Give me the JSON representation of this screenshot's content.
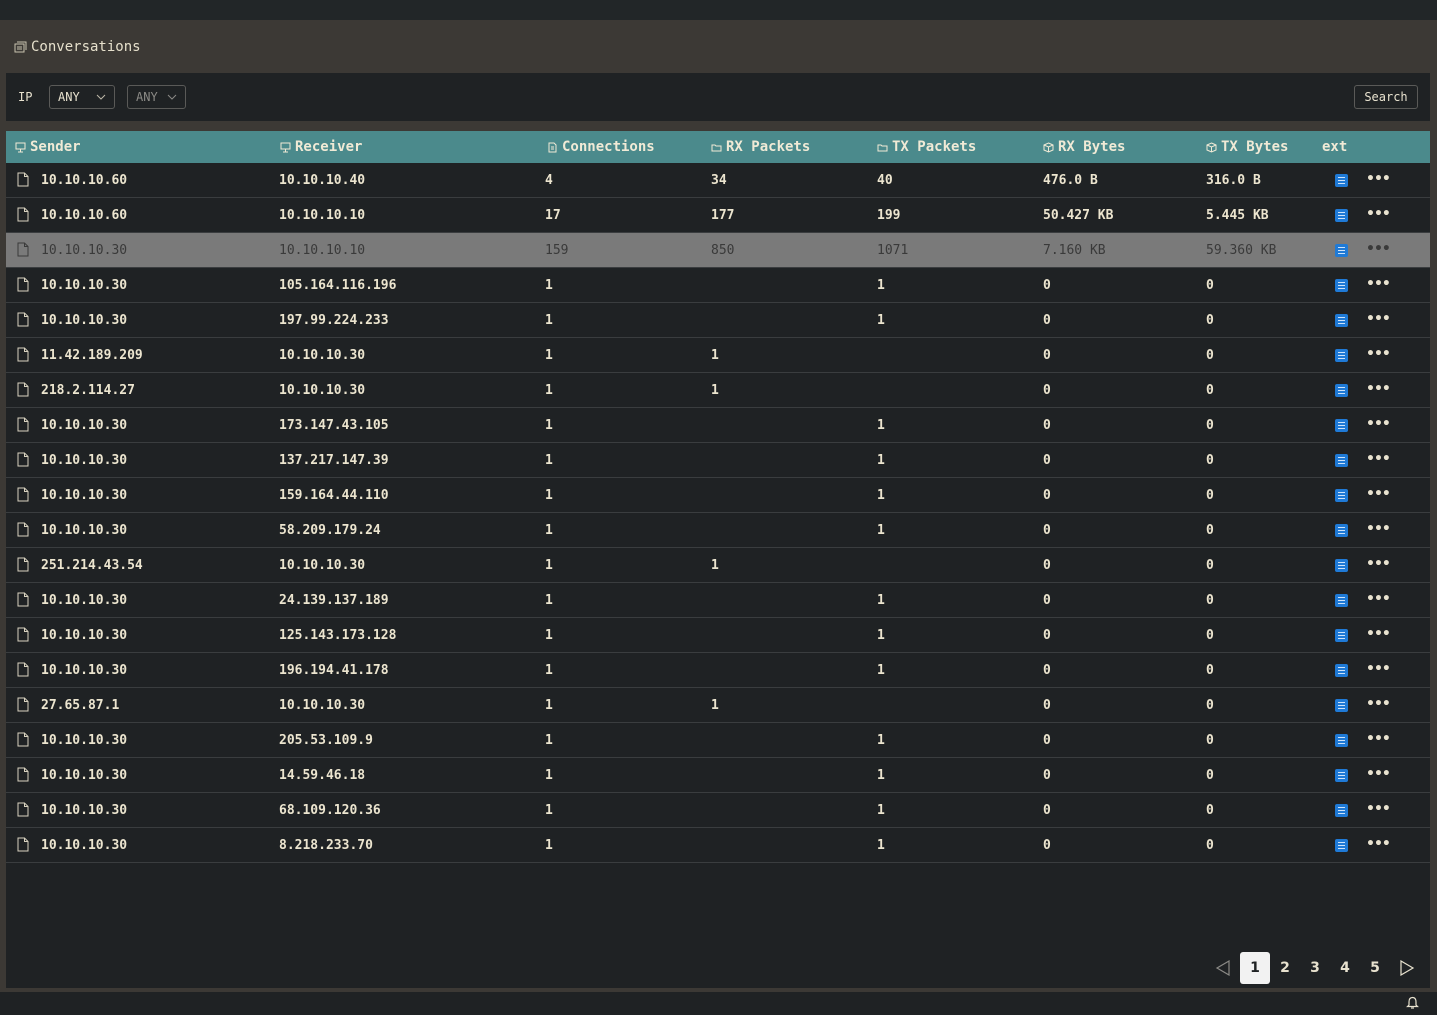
{
  "panel": {
    "title": "Conversations",
    "icon": "conversations-icon"
  },
  "filters": {
    "label": "IP",
    "select1": "ANY",
    "select2": "ANY",
    "search_label": "Search"
  },
  "table": {
    "columns": {
      "sender": "Sender",
      "receiver": "Receiver",
      "connections": "Connections",
      "rx_packets": "RX Packets",
      "tx_packets": "TX Packets",
      "rx_bytes": "RX Bytes",
      "tx_bytes": "TX Bytes",
      "ext": "ext"
    },
    "selected_row_index": 2,
    "rows": [
      {
        "sender": "10.10.10.60",
        "receiver": "10.10.10.40",
        "connections": "4",
        "rx_packets": "34",
        "tx_packets": "40",
        "rx_bytes": "476.0 B",
        "tx_bytes": "316.0 B"
      },
      {
        "sender": "10.10.10.60",
        "receiver": "10.10.10.10",
        "connections": "17",
        "rx_packets": "177",
        "tx_packets": "199",
        "rx_bytes": "50.427 KB",
        "tx_bytes": "5.445 KB"
      },
      {
        "sender": "10.10.10.30",
        "receiver": "10.10.10.10",
        "connections": "159",
        "rx_packets": "850",
        "tx_packets": "1071",
        "rx_bytes": "7.160 KB",
        "tx_bytes": "59.360 KB"
      },
      {
        "sender": "10.10.10.30",
        "receiver": "105.164.116.196",
        "connections": "1",
        "rx_packets": "",
        "tx_packets": "1",
        "rx_bytes": "0",
        "tx_bytes": "0"
      },
      {
        "sender": "10.10.10.30",
        "receiver": "197.99.224.233",
        "connections": "1",
        "rx_packets": "",
        "tx_packets": "1",
        "rx_bytes": "0",
        "tx_bytes": "0"
      },
      {
        "sender": "11.42.189.209",
        "receiver": "10.10.10.30",
        "connections": "1",
        "rx_packets": "1",
        "tx_packets": "",
        "rx_bytes": "0",
        "tx_bytes": "0"
      },
      {
        "sender": "218.2.114.27",
        "receiver": "10.10.10.30",
        "connections": "1",
        "rx_packets": "1",
        "tx_packets": "",
        "rx_bytes": "0",
        "tx_bytes": "0"
      },
      {
        "sender": "10.10.10.30",
        "receiver": "173.147.43.105",
        "connections": "1",
        "rx_packets": "",
        "tx_packets": "1",
        "rx_bytes": "0",
        "tx_bytes": "0"
      },
      {
        "sender": "10.10.10.30",
        "receiver": "137.217.147.39",
        "connections": "1",
        "rx_packets": "",
        "tx_packets": "1",
        "rx_bytes": "0",
        "tx_bytes": "0"
      },
      {
        "sender": "10.10.10.30",
        "receiver": "159.164.44.110",
        "connections": "1",
        "rx_packets": "",
        "tx_packets": "1",
        "rx_bytes": "0",
        "tx_bytes": "0"
      },
      {
        "sender": "10.10.10.30",
        "receiver": "58.209.179.24",
        "connections": "1",
        "rx_packets": "",
        "tx_packets": "1",
        "rx_bytes": "0",
        "tx_bytes": "0"
      },
      {
        "sender": "251.214.43.54",
        "receiver": "10.10.10.30",
        "connections": "1",
        "rx_packets": "1",
        "tx_packets": "",
        "rx_bytes": "0",
        "tx_bytes": "0"
      },
      {
        "sender": "10.10.10.30",
        "receiver": "24.139.137.189",
        "connections": "1",
        "rx_packets": "",
        "tx_packets": "1",
        "rx_bytes": "0",
        "tx_bytes": "0"
      },
      {
        "sender": "10.10.10.30",
        "receiver": "125.143.173.128",
        "connections": "1",
        "rx_packets": "",
        "tx_packets": "1",
        "rx_bytes": "0",
        "tx_bytes": "0"
      },
      {
        "sender": "10.10.10.30",
        "receiver": "196.194.41.178",
        "connections": "1",
        "rx_packets": "",
        "tx_packets": "1",
        "rx_bytes": "0",
        "tx_bytes": "0"
      },
      {
        "sender": "27.65.87.1",
        "receiver": "10.10.10.30",
        "connections": "1",
        "rx_packets": "1",
        "tx_packets": "",
        "rx_bytes": "0",
        "tx_bytes": "0"
      },
      {
        "sender": "10.10.10.30",
        "receiver": "205.53.109.9",
        "connections": "1",
        "rx_packets": "",
        "tx_packets": "1",
        "rx_bytes": "0",
        "tx_bytes": "0"
      },
      {
        "sender": "10.10.10.30",
        "receiver": "14.59.46.18",
        "connections": "1",
        "rx_packets": "",
        "tx_packets": "1",
        "rx_bytes": "0",
        "tx_bytes": "0"
      },
      {
        "sender": "10.10.10.30",
        "receiver": "68.109.120.36",
        "connections": "1",
        "rx_packets": "",
        "tx_packets": "1",
        "rx_bytes": "0",
        "tx_bytes": "0"
      },
      {
        "sender": "10.10.10.30",
        "receiver": "8.218.233.70",
        "connections": "1",
        "rx_packets": "",
        "tx_packets": "1",
        "rx_bytes": "0",
        "tx_bytes": "0"
      }
    ]
  },
  "pagination": {
    "current": "1",
    "pages": [
      "1",
      "2",
      "3",
      "4",
      "5"
    ],
    "prev_icon": "triangle-left-icon",
    "next_icon": "triangle-right-icon"
  },
  "statusbar": {
    "icon": "bell-icon"
  },
  "colors": {
    "header_bg": "#4b8a8c",
    "selected_row_bg": "#7a7a7a",
    "ext_button": "#1f7ad6",
    "table_bg": "#1f2224",
    "panel_bg": "#3c3935"
  }
}
